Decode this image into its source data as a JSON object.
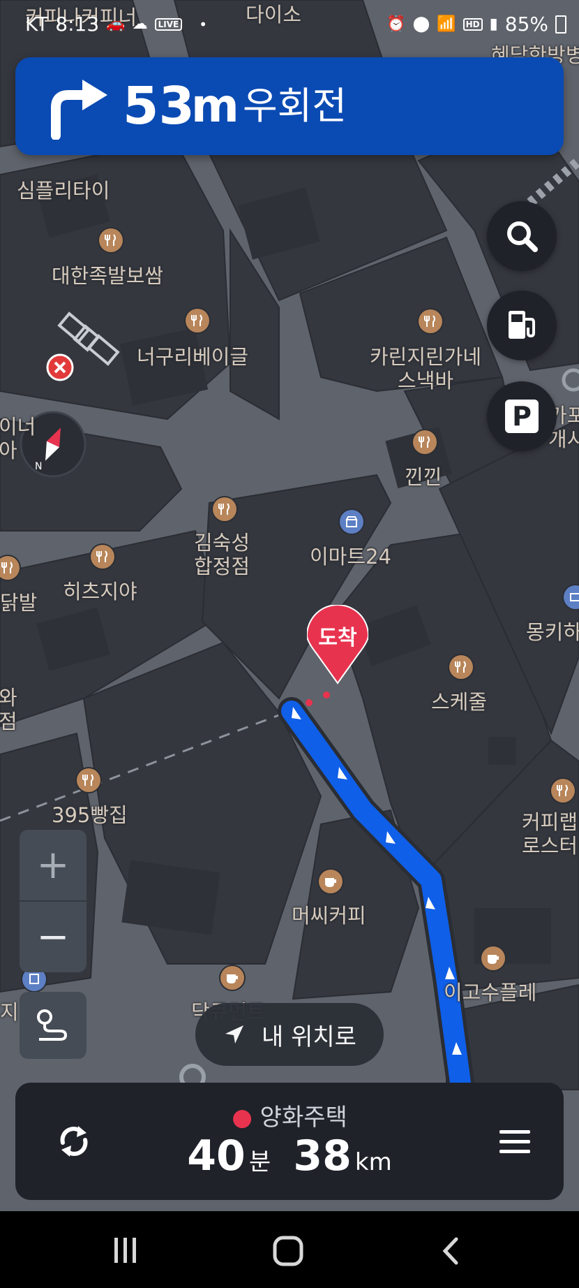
{
  "status_bar": {
    "carrier": "KT",
    "time": "8:13",
    "live_badge": "LIVE",
    "battery": "85%",
    "icons": [
      "car-icon",
      "cloud-icon",
      "live-icon",
      "dot-icon",
      "alarm-icon",
      "location-icon",
      "wifi-icon",
      "hd-icon",
      "signal-icon",
      "battery-icon"
    ]
  },
  "nav_banner": {
    "distance_value": "53",
    "distance_unit": "m",
    "instruction": "우회전",
    "turn_icon": "turn-right-icon",
    "color": "#0a4ab3"
  },
  "map": {
    "top_labels": [
      "커피나커피너",
      "다이소",
      "혜담한방병"
    ],
    "pois": [
      {
        "name": "심플리타이",
        "icon": "restaurant-icon"
      },
      {
        "name": "대한족발보쌈",
        "icon": "restaurant-icon"
      },
      {
        "name": "너구리베이글",
        "icon": "restaurant-icon"
      },
      {
        "name": "카린지린가네\n스낵바",
        "icon": "restaurant-icon"
      },
      {
        "name": "낀낀",
        "icon": "restaurant-icon"
      },
      {
        "name": "김숙성\n합정점",
        "icon": "restaurant-icon"
      },
      {
        "name": "이마트24",
        "icon": "store-icon"
      },
      {
        "name": "히츠지야",
        "icon": "restaurant-icon"
      },
      {
        "name": "스케줄",
        "icon": "restaurant-icon"
      },
      {
        "name": "395빵집",
        "icon": "restaurant-icon"
      },
      {
        "name": "머씨커피",
        "icon": "cafe-icon"
      },
      {
        "name": "커피랩\n로스터",
        "icon": "restaurant-icon"
      },
      {
        "name": "이고수플레",
        "icon": "cafe-icon"
      },
      {
        "name": "몽키하",
        "icon": "service-icon"
      },
      {
        "name": "닥큐먼트",
        "icon": "cafe-icon"
      },
      {
        "name": "닭발",
        "icon": "restaurant-icon"
      },
      {
        "name": "이너\n아",
        "icon": ""
      },
      {
        "name": "와\n점",
        "icon": ""
      },
      {
        "name": "지",
        "icon": ""
      },
      {
        "name": "카포\n개시",
        "icon": ""
      }
    ],
    "arrival_marker": "도착",
    "route_color": "#0f5fe8",
    "marker_color": "#e8334f"
  },
  "controls": {
    "search_icon": "search-icon",
    "fuel_icon": "fuel-icon",
    "parking_label": "P",
    "zoom_in_label": "+",
    "zoom_out_label": "−",
    "my_location_label": "내 위치로"
  },
  "trip_panel": {
    "destination": "양화주택",
    "eta_value": "40",
    "eta_unit": "분",
    "distance_value": "38",
    "distance_unit": "km"
  },
  "system_nav": {
    "icons": [
      "recent-apps-icon",
      "home-icon",
      "back-icon"
    ]
  }
}
